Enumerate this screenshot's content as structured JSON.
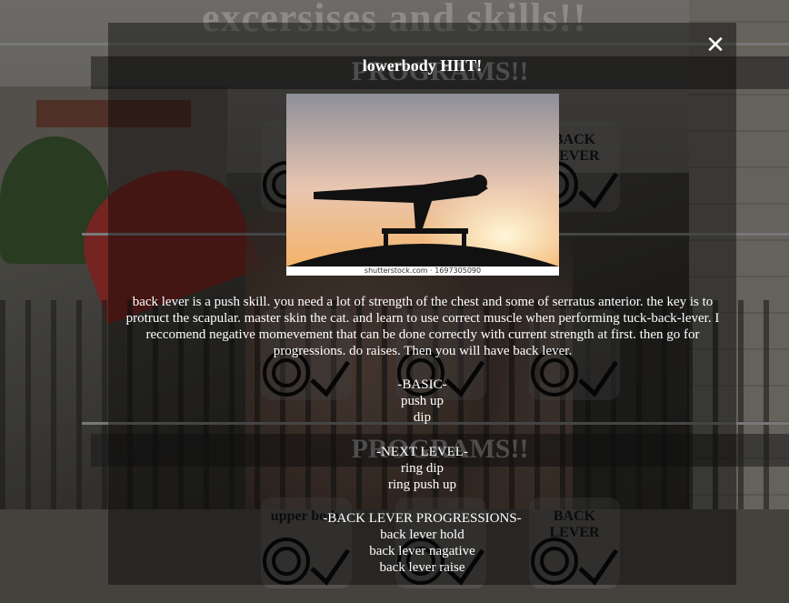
{
  "page": {
    "title": "excersises and skills!!",
    "section_label": "PROGRAMS!!"
  },
  "cards": {
    "row1": [
      "",
      "",
      "BACK LEVER"
    ],
    "row3": [
      "upper body",
      "",
      "BACK LEVER"
    ]
  },
  "modal": {
    "title": "lowerbody HIIT!",
    "close_label": "✕",
    "image_caption": "shutterstock.com · 1697305090",
    "description": "back lever is a push skill. you need a lot of strength of the chest and some of serratus anterior. the key is to protruct the scapular. master skin the cat. and learn to use correct muscle when performing tuck-back-lever. I reccomend negative momevement that can be done correctly with current strength at first. then go for progressions. do raises. Then you will have back lever.",
    "sections": [
      {
        "heading": "-BASIC-",
        "items": [
          "push up",
          "dip"
        ]
      },
      {
        "heading": "-NEXT LEVEL-",
        "items": [
          "ring dip",
          "ring push up"
        ]
      },
      {
        "heading": "-BACK LEVER PROGRESSIONS-",
        "items": [
          "back lever hold",
          "back lever nagative",
          "back lever raise"
        ]
      }
    ]
  },
  "colors": {
    "modal_bg": "#000000",
    "text": "#ffffff"
  },
  "icons": [
    "close-icon",
    "target-icon",
    "check-icon"
  ]
}
